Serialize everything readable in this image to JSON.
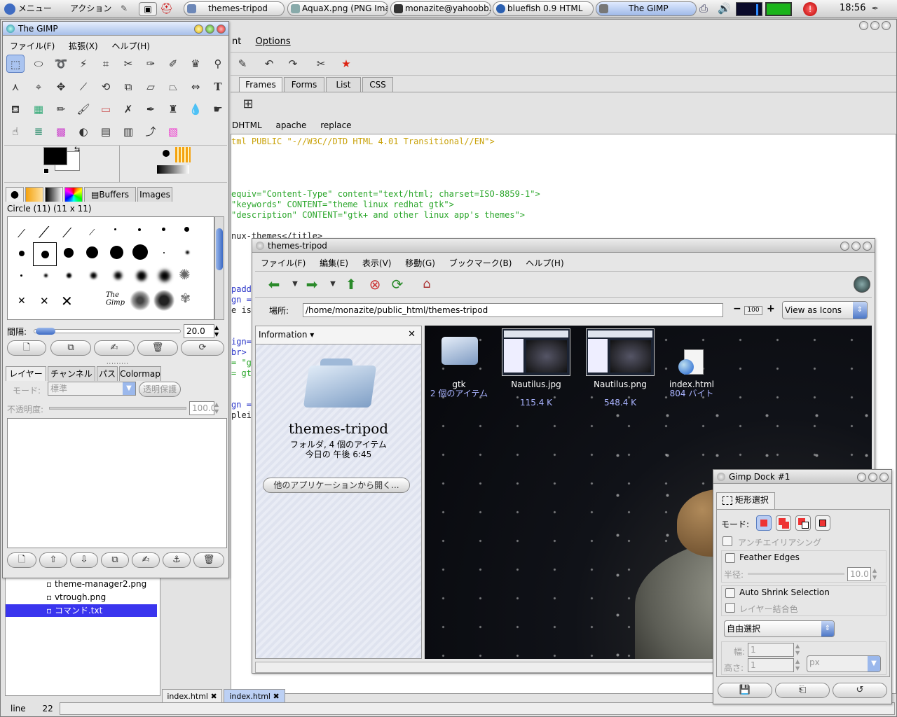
{
  "panel": {
    "menu": "メニュー",
    "actions": "アクション",
    "tasks": [
      "themes-tripod",
      "AquaX.png (PNG Ima",
      "monazite@yahoobb2",
      "bluefish 0.9 HTML",
      "The GIMP"
    ],
    "clock": "18:56"
  },
  "gimp": {
    "title": "The GIMP",
    "menu": [
      "ファイル(F)",
      "拡張(X)",
      "ヘルプ(H)"
    ],
    "tabs": [
      "Buffers",
      "Images"
    ],
    "brush_name": "Circle (11) (11 x 11)",
    "spacing_label": "間隔:",
    "spacing_value": "20.0",
    "layer_tabs": [
      "レイヤー",
      "チャンネル",
      "パス",
      "Colormap"
    ],
    "mode_label": "モード:",
    "mode_value": "標準",
    "keep_trans": "透明保護",
    "opacity_label": "不透明度:",
    "opacity_value": "100.0"
  },
  "bluefish": {
    "menu_options": "Options",
    "menu_partial": "nt",
    "tabs": [
      "Frames",
      "Forms",
      "List",
      "CSS"
    ],
    "sub_tabs": [
      "DHTML",
      "apache",
      "replace"
    ],
    "code_lines": [
      "tml PUBLIC \"-//W3C//DTD HTML 4.01 Transitional//EN\">",
      "equiv=\"Content-Type\" content=\"text/html; charset=ISO-8859-1\">",
      "\"keywords\" CONTENT=\"theme linux redhat gtk\">",
      "\"description\" CONTENT=\"gtk+ and other linux app's themes\">",
      "nux-themes</title>"
    ],
    "code_frag": [
      "padd",
      "gn =",
      "e is",
      "ign=",
      "br>",
      "= \"gt",
      "= gt",
      "gn =",
      "plei"
    ],
    "files": [
      "theme-manager2.png",
      "vtrough.png",
      "コマンド.txt"
    ],
    "doc_tabs": [
      "index.html",
      "index.html"
    ],
    "status_line_label": "line",
    "status_line_value": "22"
  },
  "nautilus": {
    "title": "themes-tripod",
    "menu": [
      "ファイル(F)",
      "編集(E)",
      "表示(V)",
      "移動(G)",
      "ブックマーク(B)",
      "ヘルプ(H)"
    ],
    "location_label": "場所:",
    "location_value": "/home/monazite/public_html/themes-tripod",
    "zoom": "100",
    "view_as": "View as Icons",
    "side_title": "Information",
    "folder_name": "themes-tripod",
    "folder_info": "フォルダ, 4 個のアイテム",
    "folder_date": "今日の 午後 6:45",
    "open_with": "他のアプリケーションから開く...",
    "items": [
      {
        "name": "gtk",
        "info": "2 個のアイテム"
      },
      {
        "name": "Nautilus.jpg",
        "info": "115.4 K"
      },
      {
        "name": "Nautilus.png",
        "info": "548.4 K"
      },
      {
        "name": "index.html",
        "info": "804 バイト"
      }
    ]
  },
  "dock": {
    "title": "Gimp Dock #1",
    "tab": "矩形選択",
    "mode_label": "モード:",
    "antialias": "アンチエイリアシング",
    "feather": "Feather Edges",
    "radius_label": "半径:",
    "radius_value": "10.0",
    "auto_shrink": "Auto Shrink Selection",
    "merge": "レイヤー結合色",
    "select_mode": "自由選択",
    "width_label": "幅:",
    "width_value": "1",
    "height_label": "高さ:",
    "height_value": "1",
    "unit": "px"
  }
}
